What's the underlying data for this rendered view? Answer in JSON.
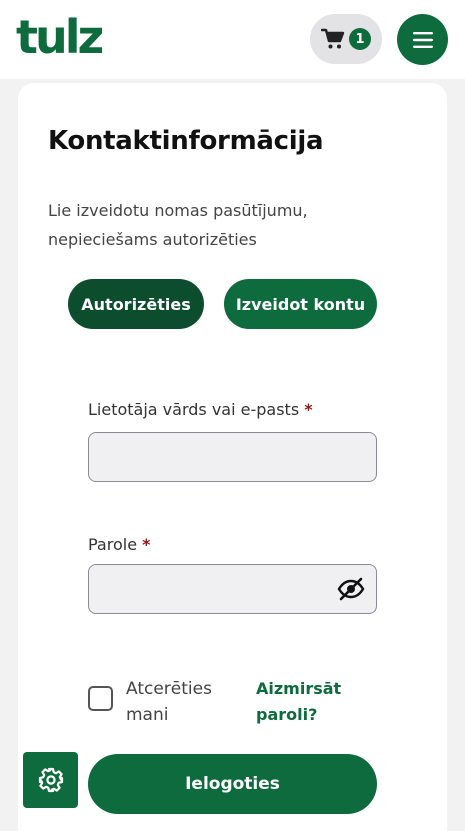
{
  "header": {
    "logo_text": "tulz",
    "cart_icon": "cart-icon",
    "cart_count": "1",
    "menu_icon": "hamburger-menu-icon"
  },
  "form": {
    "title": "Kontaktinformācija",
    "subtitle": "Lie izveidotu nomas pasūtījumu, nepieciešams autorizēties",
    "tabs": [
      {
        "label": "Autorizēties"
      },
      {
        "label": "Izveidot kontu"
      }
    ],
    "username": {
      "label": "Lietotāja vārds vai e-pasts",
      "required_mark": "*",
      "value": "",
      "placeholder": ""
    },
    "password": {
      "label": "Parole",
      "required_mark": "*",
      "value": "",
      "placeholder": "",
      "toggle_icon": "eye-slash-icon"
    },
    "remember_label": "Atcerēties mani",
    "forgot_link": "Aizmirsāt paroli?",
    "submit_label": "Ielogoties"
  },
  "settings_icon": "gear-icon",
  "colors": {
    "brand_green": "#0e6b3d",
    "brand_dark_green": "#0b4d2c",
    "required_red": "#8b1a1a"
  }
}
